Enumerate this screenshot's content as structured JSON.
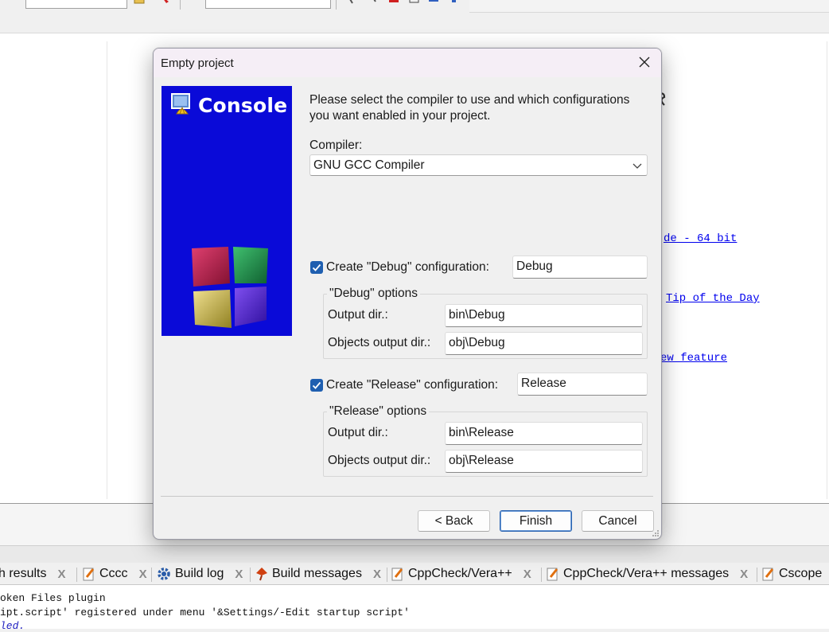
{
  "background": {
    "start_links": [
      {
        "text": "de - 64 bit"
      },
      {
        "text": "Tip of the Day"
      },
      {
        "text": "ew feature "
      }
    ],
    "tabs": [
      {
        "label": "h results",
        "icon": "none"
      },
      {
        "label": "Cccc",
        "icon": "pencil-doc-icon"
      },
      {
        "label": "Build log",
        "icon": "gear-icon"
      },
      {
        "label": "Build messages",
        "icon": "diamond-pin-icon"
      },
      {
        "label": "CppCheck/Vera++",
        "icon": "pencil-doc-icon"
      },
      {
        "label": "CppCheck/Vera++ messages",
        "icon": "pencil-doc-icon"
      },
      {
        "label": "Cscope",
        "icon": "pencil-doc-icon"
      }
    ],
    "tab_close_glyph": "X",
    "log_lines": [
      "oken Files plugin",
      "ipt.script' registered under menu '&Settings/-Edit startup script'",
      "led."
    ]
  },
  "dialog": {
    "title": "Empty project",
    "banner_title": "Console",
    "intro": "Please select the compiler to use and which configurations you want enabled in your project.",
    "compiler_label": "Compiler:",
    "compiler_value": "GNU GCC Compiler",
    "debug": {
      "checked": true,
      "label": "Create \"Debug\" configuration:",
      "name": "Debug",
      "options_title": "\"Debug\" options",
      "output_label": "Output dir.:",
      "output_value": "bin\\Debug",
      "objects_label": "Objects output dir.:",
      "objects_value": "obj\\Debug"
    },
    "release": {
      "checked": true,
      "label": "Create \"Release\" configuration:",
      "name": "Release",
      "options_title": "\"Release\" options",
      "output_label": "Output dir.:",
      "output_value": "bin\\Release",
      "objects_label": "Objects output dir.:",
      "objects_value": "obj\\Release"
    },
    "buttons": {
      "back": "< Back",
      "finish": "Finish",
      "cancel": "Cancel"
    }
  },
  "colors": {
    "banner_bg": "#0a0ad8",
    "checkbox_accent": "#1f5fb0",
    "link": "#0000ee"
  }
}
